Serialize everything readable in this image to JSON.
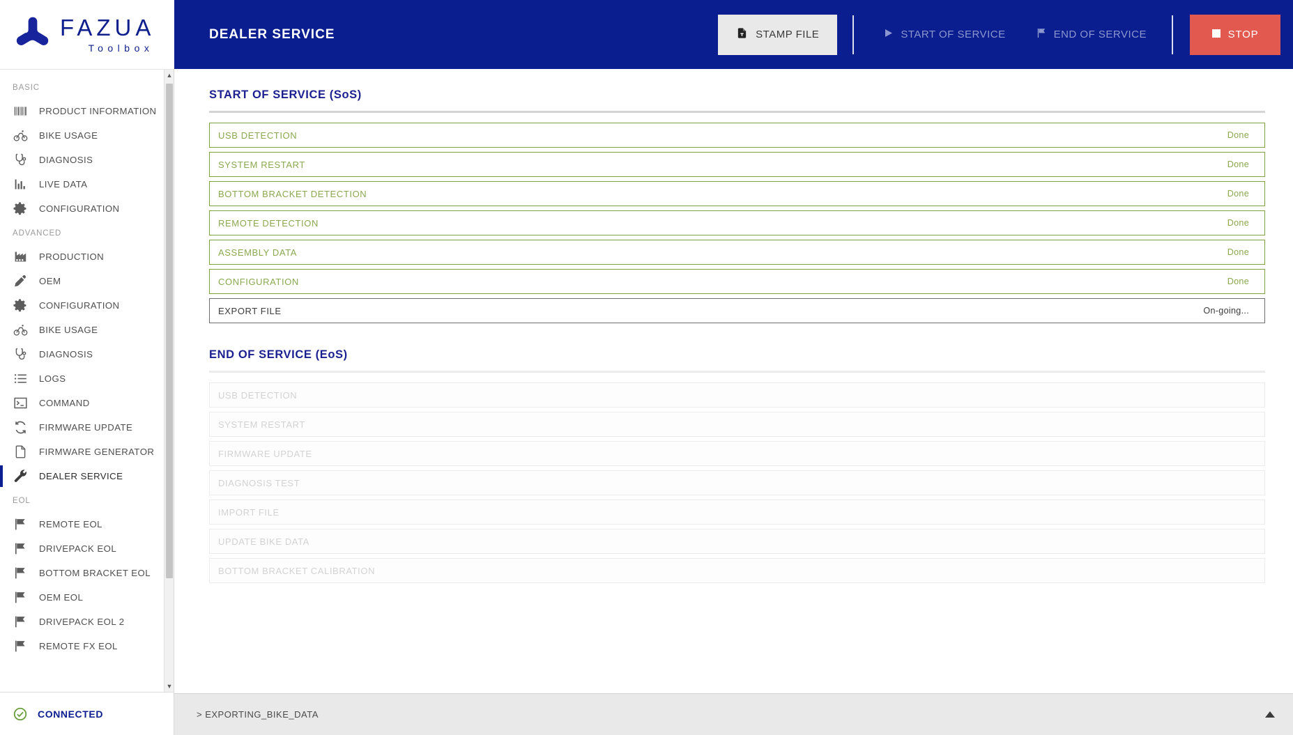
{
  "brand": {
    "name": "FAZUA",
    "sub": "Toolbox",
    "logo_icon": "fazua-logo-icon",
    "color": "#0f1f8c"
  },
  "header": {
    "title": "DEALER SERVICE",
    "accent_color": "#0b1e8f",
    "stamp_file": {
      "label": "STAMP FILE",
      "icon": "file-stamp-icon"
    },
    "start_of_service": {
      "label": "START OF SERVICE",
      "icon": "play-icon"
    },
    "end_of_service": {
      "label": "END OF SERVICE",
      "icon": "flag-icon"
    },
    "stop": {
      "label": "STOP",
      "icon": "stop-square-icon",
      "color": "#e2594f"
    }
  },
  "sidebar": {
    "groups": [
      {
        "label": "BASIC",
        "items": [
          {
            "label": "PRODUCT INFORMATION",
            "icon": "barcode-icon",
            "active": false
          },
          {
            "label": "BIKE USAGE",
            "icon": "bicycle-icon",
            "active": false
          },
          {
            "label": "DIAGNOSIS",
            "icon": "stethoscope-icon",
            "active": false
          },
          {
            "label": "LIVE DATA",
            "icon": "bar-chart-icon",
            "active": false
          },
          {
            "label": "CONFIGURATION",
            "icon": "gear-icon",
            "active": false
          }
        ]
      },
      {
        "label": "ADVANCED",
        "items": [
          {
            "label": "PRODUCTION",
            "icon": "factory-icon",
            "active": false
          },
          {
            "label": "OEM",
            "icon": "pen-icon",
            "active": false
          },
          {
            "label": "CONFIGURATION",
            "icon": "gear-icon",
            "active": false
          },
          {
            "label": "BIKE USAGE",
            "icon": "bicycle-icon",
            "active": false
          },
          {
            "label": "DIAGNOSIS",
            "icon": "stethoscope-icon",
            "active": false
          },
          {
            "label": "LOGS",
            "icon": "list-icon",
            "active": false
          },
          {
            "label": "COMMAND",
            "icon": "terminal-icon",
            "active": false
          },
          {
            "label": "FIRMWARE UPDATE",
            "icon": "refresh-icon",
            "active": false
          },
          {
            "label": "FIRMWARE GENERATOR",
            "icon": "document-icon",
            "active": false
          },
          {
            "label": "DEALER SERVICE",
            "icon": "wrench-icon",
            "active": true
          }
        ]
      },
      {
        "label": "EOL",
        "items": [
          {
            "label": "REMOTE EOL",
            "icon": "flag-icon",
            "active": false
          },
          {
            "label": "DRIVEPACK EOL",
            "icon": "flag-icon",
            "active": false
          },
          {
            "label": "BOTTOM BRACKET EOL",
            "icon": "flag-icon",
            "active": false
          },
          {
            "label": "OEM EOL",
            "icon": "flag-icon",
            "active": false
          },
          {
            "label": "DRIVEPACK EOL 2",
            "icon": "flag-icon",
            "active": false
          },
          {
            "label": "REMOTE FX EOL",
            "icon": "flag-icon",
            "active": false
          }
        ]
      }
    ],
    "connection": {
      "label": "CONNECTED",
      "icon": "check-circle-icon",
      "color": "#6d9f3f"
    }
  },
  "main": {
    "sos": {
      "title": "START OF SERVICE (SoS)",
      "steps": [
        {
          "name": "USB DETECTION",
          "state": "Done",
          "status": "done"
        },
        {
          "name": "SYSTEM RESTART",
          "state": "Done",
          "status": "done"
        },
        {
          "name": "BOTTOM BRACKET DETECTION",
          "state": "Done",
          "status": "done"
        },
        {
          "name": "REMOTE DETECTION",
          "state": "Done",
          "status": "done"
        },
        {
          "name": "ASSEMBLY DATA",
          "state": "Done",
          "status": "done"
        },
        {
          "name": "CONFIGURATION",
          "state": "Done",
          "status": "done"
        },
        {
          "name": "EXPORT FILE",
          "state": "On-going...",
          "status": "ongoing"
        }
      ]
    },
    "eos": {
      "title": "END OF SERVICE (EoS)",
      "steps": [
        {
          "name": "USB DETECTION",
          "state": "",
          "status": "disabled"
        },
        {
          "name": "SYSTEM RESTART",
          "state": "",
          "status": "disabled"
        },
        {
          "name": "FIRMWARE UPDATE",
          "state": "",
          "status": "disabled"
        },
        {
          "name": "DIAGNOSIS TEST",
          "state": "",
          "status": "disabled"
        },
        {
          "name": "IMPORT FILE",
          "state": "",
          "status": "disabled"
        },
        {
          "name": "UPDATE BIKE DATA",
          "state": "",
          "status": "disabled"
        },
        {
          "name": "BOTTOM BRACKET CALIBRATION",
          "state": "",
          "status": "disabled"
        }
      ]
    }
  },
  "console": {
    "line": "> EXPORTING_BIKE_DATA",
    "toggle_icon": "chevron-up-icon"
  }
}
